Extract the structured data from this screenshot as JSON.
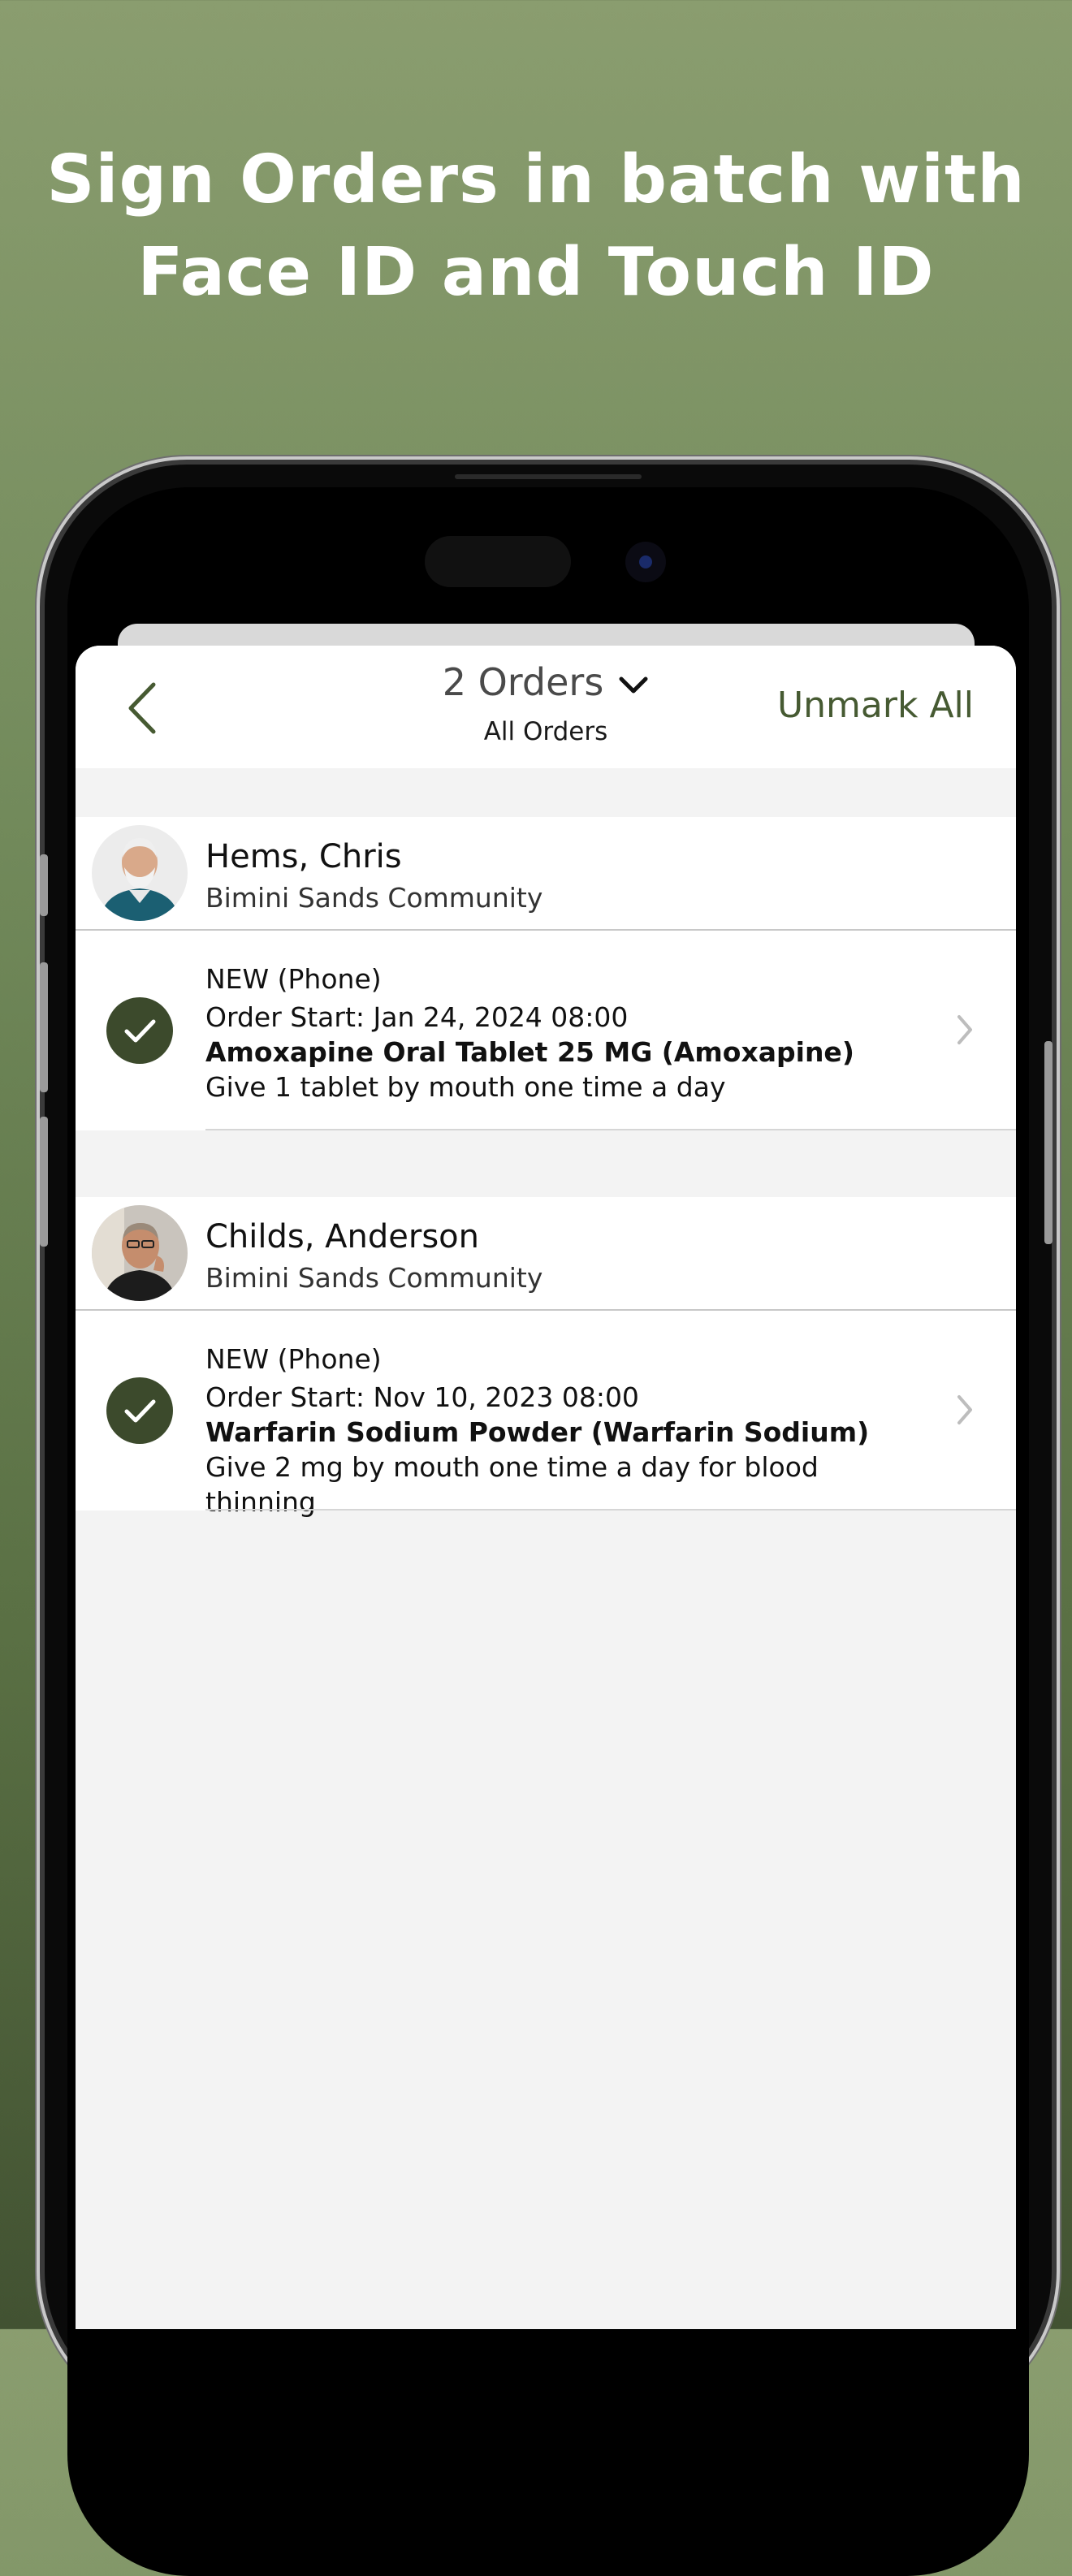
{
  "headline": {
    "line1": "Sign Orders in batch with",
    "line2": "Face ID and Touch ID"
  },
  "navbar": {
    "title": "2 Orders",
    "subtitle": "All Orders",
    "action": "Unmark All"
  },
  "groups": [
    {
      "patient_name": "Hems, Chris",
      "community": "Bimini Sands Community",
      "order": {
        "status": "NEW (Phone)",
        "start": "Order Start: Jan 24, 2024 08:00",
        "drug": "Amoxapine Oral Tablet 25 MG (Amoxapine)",
        "instructions": " Give 1 tablet by mouth one time a day",
        "selected": true
      }
    },
    {
      "patient_name": "Childs, Anderson",
      "community": "Bimini Sands Community",
      "order": {
        "status": "NEW (Phone)",
        "start": "Order Start: Nov 10, 2023 08:00",
        "drug": "Warfarin Sodium Powder (Warfarin Sodium)",
        "instructions": " Give 2 mg by mouth one time a day for blood thinning",
        "selected": true
      }
    }
  ],
  "colors": {
    "accent": "#465a32",
    "check_fill": "#3c4a2c"
  },
  "icons": [
    "back-chevron-icon",
    "chevron-down-icon",
    "checkmark-icon",
    "chevron-right-icon"
  ]
}
